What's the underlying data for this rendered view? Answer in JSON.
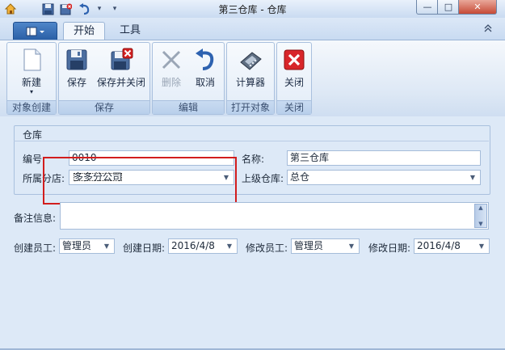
{
  "window": {
    "title": "第三仓库 - 仓库",
    "min_label": "—",
    "max_label": "□",
    "close_label": "✕"
  },
  "ribbon": {
    "tabs": [
      "开始",
      "工具"
    ],
    "collapse_glyph": "≈",
    "groups": [
      {
        "label": "对象创建",
        "buttons": [
          {
            "label": "新建",
            "sub": "▾",
            "icon": "new-document-icon",
            "enabled": true
          }
        ]
      },
      {
        "label": "保存",
        "buttons": [
          {
            "label": "保存",
            "icon": "floppy-save-icon",
            "enabled": true
          },
          {
            "label": "保存并关闭",
            "icon": "save-close-icon",
            "enabled": true
          }
        ]
      },
      {
        "label": "编辑",
        "buttons": [
          {
            "label": "删除",
            "icon": "delete-x-icon",
            "enabled": false
          },
          {
            "label": "取消",
            "icon": "undo-arrow-icon",
            "enabled": true
          }
        ]
      },
      {
        "label": "打开对象",
        "buttons": [
          {
            "label": "计算器",
            "icon": "calculator-icon",
            "enabled": true
          }
        ]
      },
      {
        "label": "关闭",
        "buttons": [
          {
            "label": "关闭",
            "icon": "red-close-icon",
            "enabled": true
          }
        ]
      }
    ]
  },
  "form": {
    "section_title": "仓库",
    "code_label": "编号:",
    "code_value": "0010",
    "name_label": "名称:",
    "name_value": "第三仓库",
    "branch_label": "所属分店:",
    "branch_value": "多多分公司",
    "parent_label": "上级仓库:",
    "parent_value": "总仓",
    "remarks_label": "备注信息:",
    "remarks_value": "",
    "creator_label": "创建员工:",
    "creator_value": "管理员",
    "created_date_label": "创建日期:",
    "created_date_value": "2016/4/8",
    "modifier_label": "修改员工:",
    "modifier_value": "管理员",
    "modified_date_label": "修改日期:",
    "modified_date_value": "2016/4/8"
  },
  "colors": {
    "accent": "#2a5fa6",
    "highlight_box": "#d21d1d",
    "form_background": "#dde9f7"
  }
}
